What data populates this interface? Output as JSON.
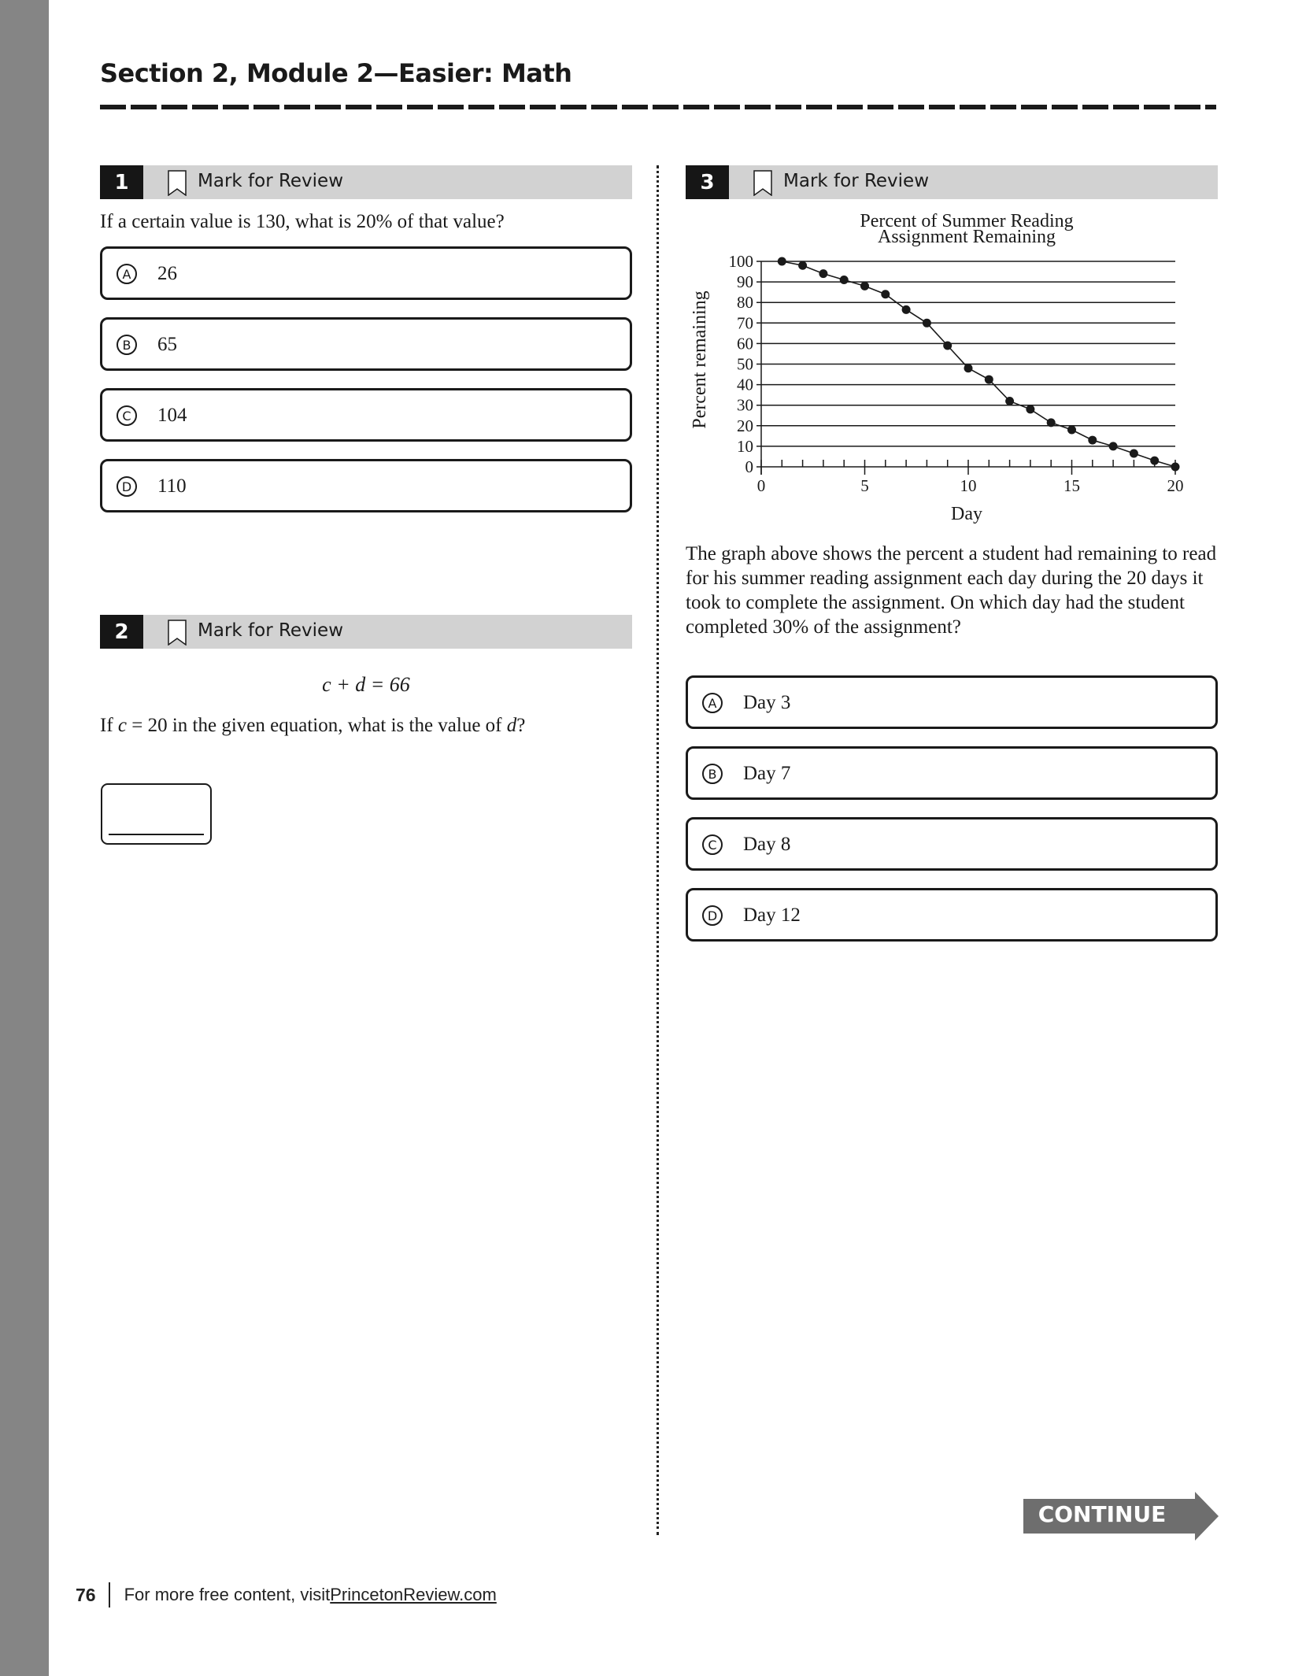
{
  "header": {
    "title": "Section 2, Module 2—Easier: Math"
  },
  "questions": [
    {
      "number": "1",
      "mark_label": "Mark for Review",
      "text": "If a certain value is 130, what is 20% of that value?",
      "choices": [
        {
          "letter": "A",
          "text": "26"
        },
        {
          "letter": "B",
          "text": "65"
        },
        {
          "letter": "C",
          "text": "104"
        },
        {
          "letter": "D",
          "text": "110"
        }
      ]
    },
    {
      "number": "2",
      "mark_label": "Mark for Review",
      "equation": "c + d = 66",
      "text_prefix": "If ",
      "text_var1": "c",
      "text_mid": " = 20 in the given equation, what is the value of ",
      "text_var2": "d",
      "text_suffix": "?",
      "answer_value": ""
    },
    {
      "number": "3",
      "mark_label": "Mark for Review",
      "text": "The graph above shows the percent a student had remaining to read for his summer reading assignment each day during the 20 days it took to complete the assignment. On which day had the student completed 30% of the assignment?",
      "choices": [
        {
          "letter": "A",
          "text": "Day 3"
        },
        {
          "letter": "B",
          "text": "Day 7"
        },
        {
          "letter": "C",
          "text": "Day 8"
        },
        {
          "letter": "D",
          "text": "Day 12"
        }
      ]
    }
  ],
  "chart_data": {
    "type": "line",
    "title": "Percent of Summer Reading Assignment Remaining",
    "title_lines": [
      "Percent of Summer Reading",
      "Assignment Remaining"
    ],
    "xlabel": "Day",
    "ylabel": "Percent remaining",
    "xlim": [
      0,
      20
    ],
    "ylim": [
      0,
      100
    ],
    "x_ticks": [
      0,
      5,
      10,
      15,
      20
    ],
    "x_minor_step": 1,
    "y_ticks": [
      0,
      10,
      20,
      30,
      40,
      50,
      60,
      70,
      80,
      90,
      100
    ],
    "grid": "horizontal",
    "legend": "none",
    "series": [
      {
        "name": "Percent remaining",
        "x": [
          1,
          2,
          3,
          4,
          5,
          6,
          7,
          8,
          9,
          10,
          11,
          12,
          13,
          14,
          15,
          16,
          17,
          18,
          19,
          20
        ],
        "values": [
          100,
          98,
          94,
          91,
          88,
          84,
          76.5,
          70,
          59,
          48,
          42.5,
          32,
          28,
          21.5,
          18,
          13,
          10,
          6.5,
          3,
          0
        ]
      }
    ]
  },
  "navigation": {
    "continue_label": "CONTINUE"
  },
  "footer": {
    "page_number": "76",
    "text": "For more free content, visit ",
    "link": "PrincetonReview.com"
  }
}
